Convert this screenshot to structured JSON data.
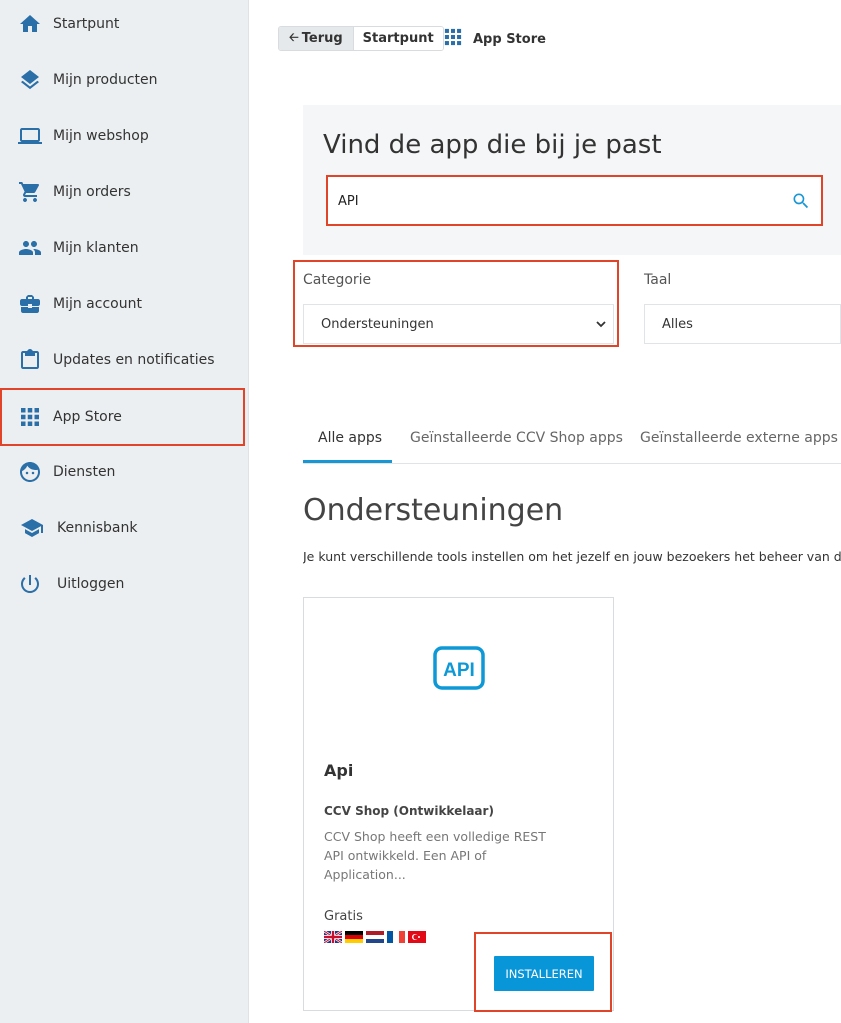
{
  "sidebar": {
    "items": [
      {
        "label": "Startpunt",
        "icon": "home-icon"
      },
      {
        "label": "Mijn producten",
        "icon": "layers-icon"
      },
      {
        "label": "Mijn webshop",
        "icon": "laptop-icon"
      },
      {
        "label": "Mijn orders",
        "icon": "cart-icon"
      },
      {
        "label": "Mijn klanten",
        "icon": "people-icon"
      },
      {
        "label": "Mijn account",
        "icon": "briefcase-icon"
      },
      {
        "label": "Updates en notificaties",
        "icon": "clipboard-icon"
      },
      {
        "label": "App Store",
        "icon": "grid-icon"
      },
      {
        "label": "Diensten",
        "icon": "face-icon"
      },
      {
        "label": "Kennisbank",
        "icon": "school-icon"
      },
      {
        "label": "Uitloggen",
        "icon": "power-icon"
      }
    ]
  },
  "header": {
    "back_label": "Terug",
    "home_crumb": "Startpunt",
    "current_page": "App Store"
  },
  "search": {
    "title": "Vind de app die bij je past",
    "value": "API"
  },
  "filters": {
    "category_label": "Categorie",
    "category_value": "Ondersteuningen",
    "language_label": "Taal",
    "language_value": "Alles"
  },
  "tabs": [
    {
      "label": "Alle apps",
      "active": true
    },
    {
      "label": "Geïnstalleerde CCV Shop apps",
      "active": false
    },
    {
      "label": "Geïnstalleerde externe apps",
      "active": false
    }
  ],
  "section": {
    "title": "Ondersteuningen",
    "description": "Je kunt verschillende tools instellen om het jezelf en jouw bezoekers het beheer van de w"
  },
  "card": {
    "logo_text": "API",
    "name": "Api",
    "vendor": "CCV Shop (Ontwikkelaar)",
    "description": "CCV Shop heeft een volledige REST API ontwikkeld. Een API of Application...",
    "price": "Gratis",
    "flags": [
      "uk-flag-icon",
      "germany-flag-icon",
      "netherlands-flag-icon",
      "france-flag-icon",
      "turkey-flag-icon"
    ],
    "install_label": "INSTALLEREN"
  },
  "colors": {
    "accent": "#1997d4",
    "icon_blue": "#2a6fa8",
    "highlight": "#e0452a",
    "button": "#0996d8"
  }
}
